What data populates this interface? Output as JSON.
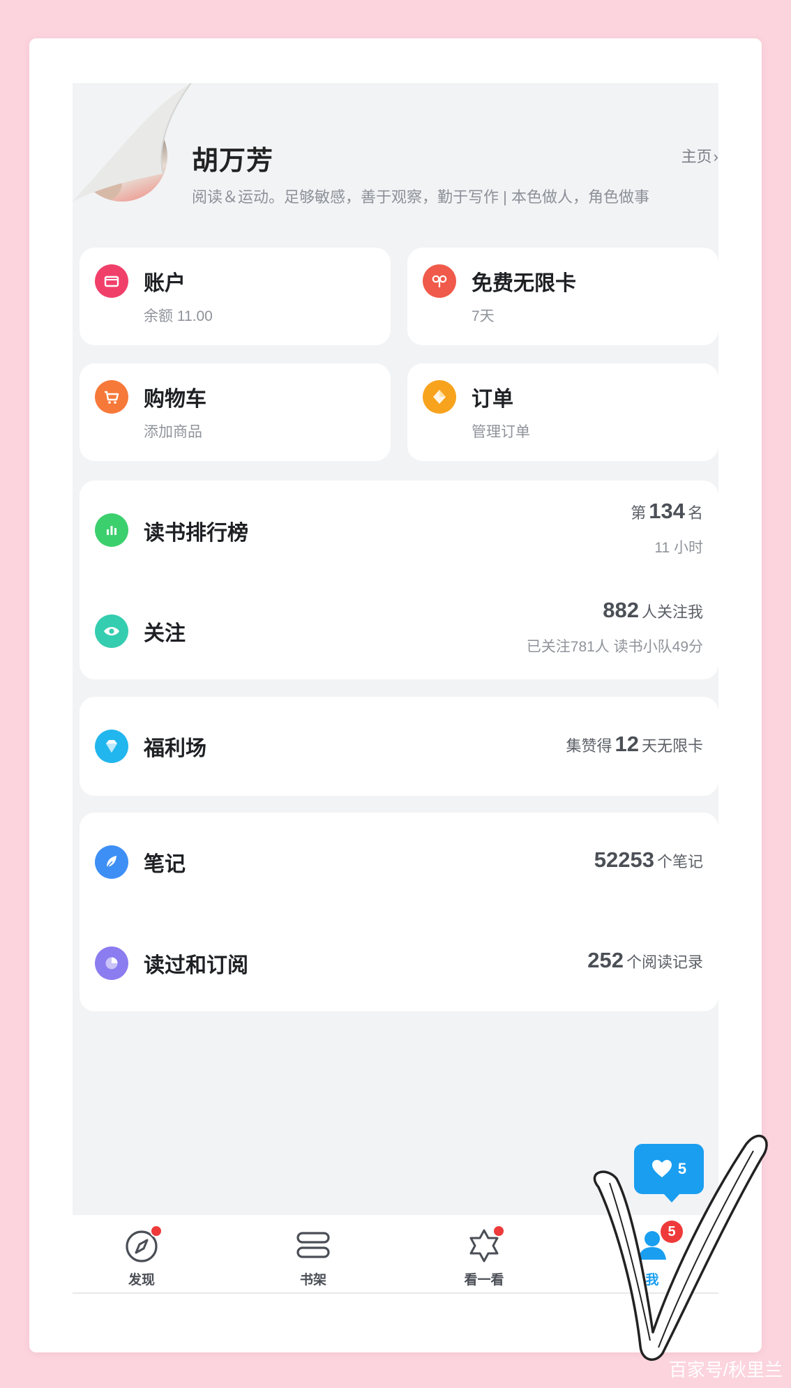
{
  "profile": {
    "name": "胡万芳",
    "bio": "阅读＆运动。足够敏感，善于观察，勤于写作 | 本色做人，角色做事",
    "homepage_label": "主页",
    "homepage_chevron": "›"
  },
  "tiles": {
    "account": {
      "title": "账户",
      "sub": "余额 11.00",
      "color": "#f0406a"
    },
    "free_card": {
      "title": "免费无限卡",
      "sub": "7天",
      "color": "#f05a4a"
    },
    "cart": {
      "title": "购物车",
      "sub": "添加商品",
      "color": "#f6793a"
    },
    "orders": {
      "title": "订单",
      "sub": "管理订单",
      "color": "#f8a31e"
    }
  },
  "ranking": {
    "title": "读书排行榜",
    "prefix": "第",
    "rank": "134",
    "suffix": "名",
    "sub": "11 小时",
    "color": "#3ccf6e"
  },
  "follow": {
    "title": "关注",
    "count": "882",
    "suffix": "人关注我",
    "sub": "已关注781人 读书小队49分",
    "color": "#35cdb0"
  },
  "welfare": {
    "title": "福利场",
    "prefix": "集赞得",
    "days": "12",
    "suffix": "天无限卡",
    "color": "#22b6ee"
  },
  "notes": {
    "title": "笔记",
    "count": "52253",
    "suffix": "个笔记",
    "color": "#3d8ff6"
  },
  "history": {
    "title": "读过和订阅",
    "count": "252",
    "suffix": "个阅读记录",
    "color": "#8b7cf0"
  },
  "like_bubble": {
    "count": "5"
  },
  "nav": {
    "items": [
      {
        "label": "发现",
        "icon": "compass-icon",
        "dot": true
      },
      {
        "label": "书架",
        "icon": "bookshelf-icon",
        "dot": false
      },
      {
        "label": "看一看",
        "icon": "star-hexagon-icon",
        "dot": true
      },
      {
        "label": "我",
        "icon": "user-icon",
        "badge": "5",
        "active": true,
        "active_color": "#1a9ef0"
      }
    ]
  },
  "watermark": "百家号/秋里兰"
}
